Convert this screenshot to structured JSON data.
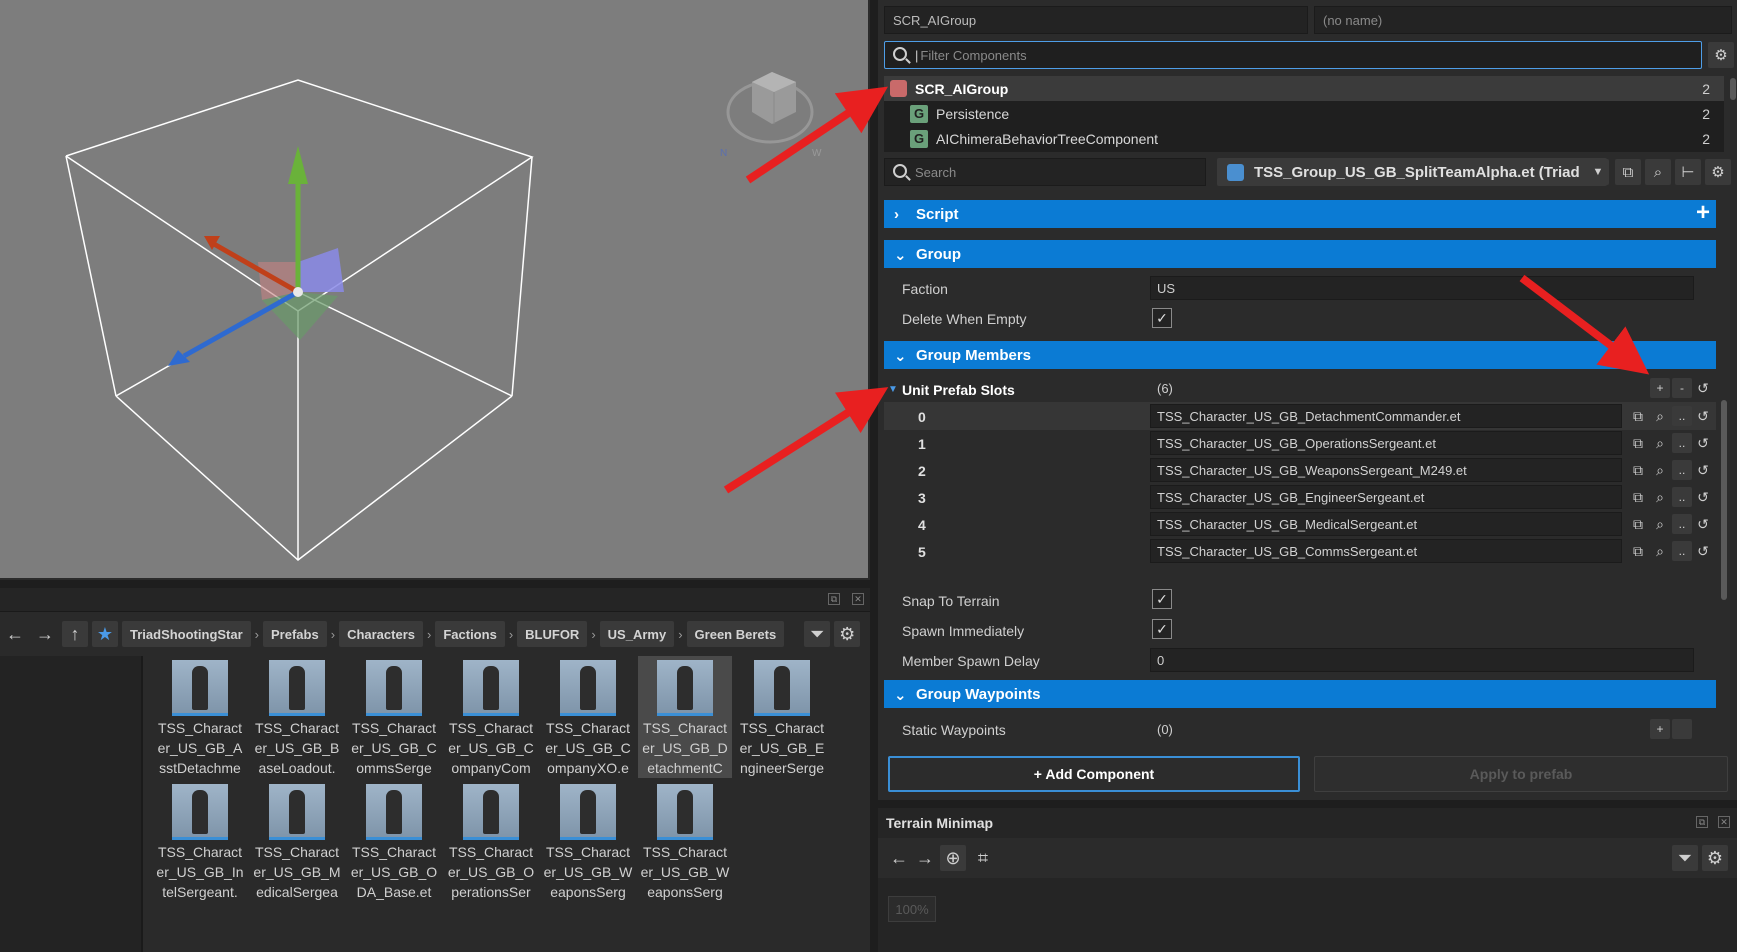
{
  "viewport": {
    "gizmo_labels": [
      "N",
      "W"
    ]
  },
  "browser": {
    "breadcrumbs": [
      "TriadShootingStar",
      "Prefabs",
      "Characters",
      "Factions",
      "BLUFOR",
      "US_Army",
      "Green Berets"
    ],
    "assets": [
      "TSS_Character_US_GB_AsstDetachme",
      "TSS_Character_US_GB_BaseLoadout.",
      "TSS_Character_US_GB_CommsSerge",
      "TSS_Character_US_GB_CompanyCom",
      "TSS_Character_US_GB_CompanyXO.e",
      "TSS_Character_US_GB_DetachmentC",
      "TSS_Character_US_GB_EngineerSerge",
      "TSS_Character_US_GB_IntelSergeant.",
      "TSS_Character_US_GB_MedicalSergea",
      "TSS_Character_US_GB_ODA_Base.et",
      "TSS_Character_US_GB_OperationsSer",
      "TSS_Character_US_GB_WeaponsSerg",
      "TSS_Character_US_GB_WeaponsSerg"
    ],
    "selected_index": 5
  },
  "entity": {
    "class_name": "SCR_AIGroup",
    "name_placeholder": "(no name)"
  },
  "filter": {
    "placeholder": "Filter Components"
  },
  "components": [
    {
      "name": "SCR_AIGroup",
      "count": "2"
    },
    {
      "name": "Persistence",
      "count": "2"
    },
    {
      "name": "AIChimeraBehaviorTreeComponent",
      "count": "2"
    }
  ],
  "prop_search": {
    "placeholder": "Search"
  },
  "prefab": {
    "name": "TSS_Group_US_GB_SplitTeamAlpha.et (Triad"
  },
  "sections": {
    "script": "Script",
    "group": "Group",
    "group_members": "Group Members",
    "group_waypoints": "Group Waypoints"
  },
  "group": {
    "faction_label": "Faction",
    "faction_value": "US",
    "delete_when_empty_label": "Delete When Empty",
    "delete_when_empty": true
  },
  "members": {
    "slots_label": "Unit Prefab Slots",
    "slots_count": "(6)",
    "slots": [
      {
        "index": "0",
        "value": "TSS_Character_US_GB_DetachmentCommander.et"
      },
      {
        "index": "1",
        "value": "TSS_Character_US_GB_OperationsSergeant.et"
      },
      {
        "index": "2",
        "value": "TSS_Character_US_GB_WeaponsSergeant_M249.et"
      },
      {
        "index": "3",
        "value": "TSS_Character_US_GB_EngineerSergeant.et"
      },
      {
        "index": "4",
        "value": "TSS_Character_US_GB_MedicalSergeant.et"
      },
      {
        "index": "5",
        "value": "TSS_Character_US_GB_CommsSergeant.et"
      }
    ],
    "snap_label": "Snap To Terrain",
    "snap": true,
    "spawn_label": "Spawn Immediately",
    "spawn": true,
    "delay_label": "Member Spawn Delay",
    "delay_value": "0"
  },
  "waypoints": {
    "static_label": "Static Waypoints",
    "static_count": "(0)"
  },
  "buttons": {
    "add_component": "+ Add Component",
    "apply_prefab": "Apply to prefab"
  },
  "minimap": {
    "title": "Terrain Minimap",
    "zoom": "100%"
  },
  "colors": {
    "accent": "#0b7bd4",
    "arrow": "#e82020",
    "viewport": "#7d7d7d"
  }
}
